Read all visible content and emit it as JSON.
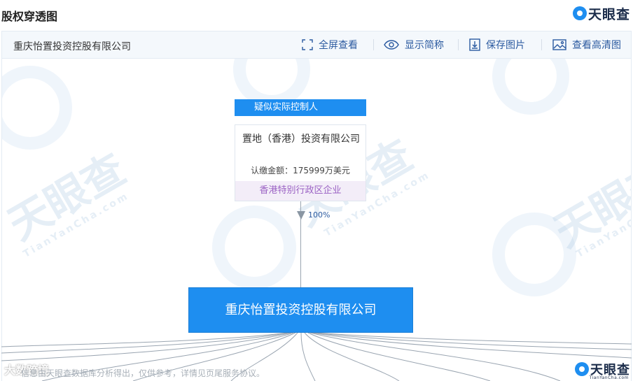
{
  "header": {
    "title": "股权穿透图",
    "brand": "天眼查"
  },
  "toolbar": {
    "company": "重庆怡置投资控股有限公司",
    "fullscreen": "全屏查看",
    "show_short": "显示简称",
    "save_image": "保存图片",
    "hd_view": "查看高清图"
  },
  "controller": {
    "label": "疑似实际控制人",
    "name": "置地（香港）投资有限公司",
    "amount": "认缴金额：175999万美元",
    "tag": "香港特别行政区企业",
    "percent": "100%"
  },
  "main_node": {
    "name": "重庆怡置投资控股有限公司"
  },
  "watermark": {
    "brand": "天眼查",
    "site": "TianYanCha.com"
  },
  "footer": {
    "note": "信息由天眼查数据库分析得出，仅供参考，详情见页尾服务协议。",
    "brand": "天眼查",
    "site": "TianYanCha.com",
    "left_logo": "大数跨境"
  },
  "colors": {
    "accent": "#1e8ef0",
    "link": "#2b5aa0",
    "tag_bg": "#f3edf8",
    "tag_text": "#9b62c4"
  }
}
